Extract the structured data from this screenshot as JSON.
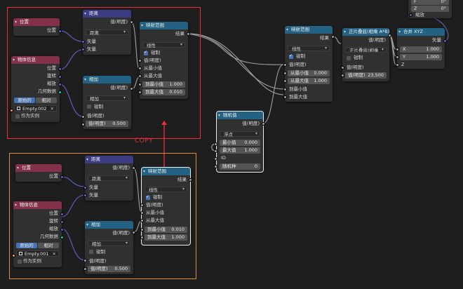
{
  "annotation": {
    "copy_label": "COPY",
    "arrow_color": "#e8303a"
  },
  "frames": {
    "top_color": "#e8303a",
    "bottom_color": "#e08a3c"
  },
  "common": {
    "position": "位置",
    "result": "结果",
    "value_out": "值(明度)",
    "location": "位置",
    "rotation": "旋转",
    "scale": "缩放",
    "geometry": "几何数据",
    "original": "原始的",
    "relative": "相对",
    "as_instance": "作为实例",
    "distance": "距离",
    "vector": "矢量",
    "add": "相加",
    "clamp": "钳制",
    "value": "值(明度)",
    "map_range": "映射范围",
    "linear": "线性",
    "from_min": "从最小值",
    "from_max": "从最大值",
    "to_min": "到最小值",
    "to_max": "到最大值"
  },
  "top_group": {
    "pos_node": {
      "title": "位置"
    },
    "obj_node": {
      "title": "物体信息",
      "object": "Empty.002"
    },
    "dist_node": {
      "title": "距离",
      "mode": "距离"
    },
    "add_node": {
      "title": "相加",
      "mode": "相加",
      "value": "0.500"
    },
    "map_node": {
      "title": "映射范围",
      "mode": "线性",
      "to_min": "1.000",
      "to_max": "0.010"
    }
  },
  "bottom_group": {
    "pos_node": {
      "title": "位置"
    },
    "obj_node": {
      "title": "物体信息",
      "object": "Empty.001"
    },
    "dist_node": {
      "title": "距离",
      "mode": "距离"
    },
    "add_node": {
      "title": "相加",
      "mode": "相加",
      "value": "0.500"
    },
    "map_node": {
      "title": "映射范围",
      "mode": "线性",
      "to_min": "0.010",
      "to_max": "1.000"
    }
  },
  "random_node": {
    "title": "随机值",
    "mode": "浮点",
    "min_label": "最小值",
    "min": "0.000",
    "max_label": "最大值",
    "max": "1.000",
    "id_label": "ID",
    "seed_label": "随机种",
    "seed": "0"
  },
  "right_map_node": {
    "title": "映射范围",
    "mode": "线性",
    "from_min": "0.000",
    "from_max": "1.000"
  },
  "multiply_node": {
    "title": "正片叠底(相乘 A*B)",
    "mode": "正片叠底(相乘 A*B)",
    "value": "23.500"
  },
  "combine_node": {
    "title": "合并 XYZ",
    "out": "矢量",
    "x_label": "X",
    "x": "1.000",
    "y_label": "Y",
    "y": "1.000",
    "z_label": "Z"
  },
  "partial_node": {
    "f_label": "F",
    "f_val": "0°",
    "z_label": "Z",
    "z_val": "0°",
    "scale_label": "缩放"
  }
}
